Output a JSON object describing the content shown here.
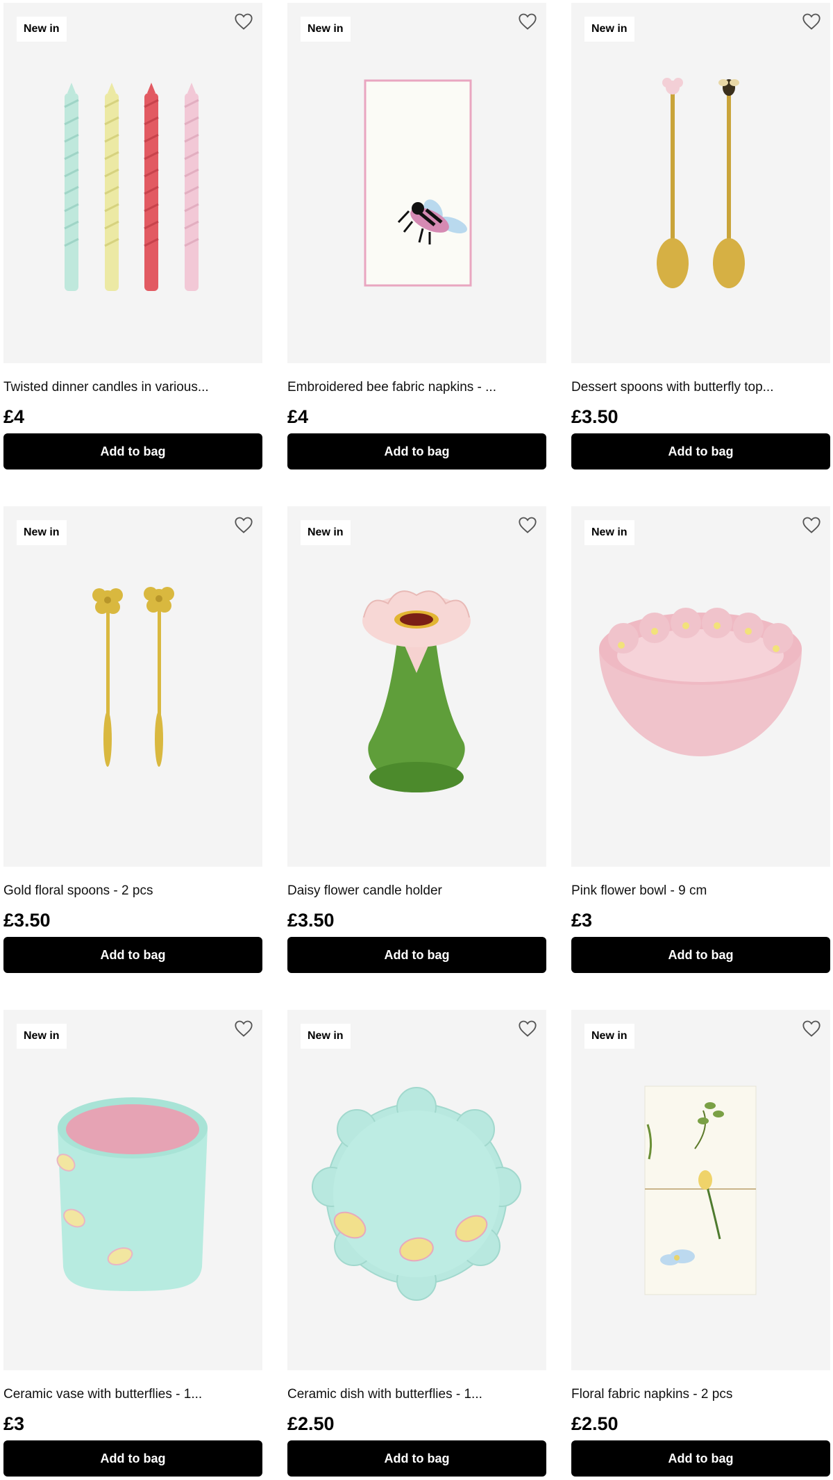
{
  "products": [
    {
      "badge": "New in",
      "title": "Twisted dinner candles in various...",
      "price": "£4",
      "button": "Add to bag",
      "image": "twisted-candles"
    },
    {
      "badge": "New in",
      "title": "Embroidered bee fabric napkins - ...",
      "price": "£4",
      "button": "Add to bag",
      "image": "bee-napkins"
    },
    {
      "badge": "New in",
      "title": "Dessert spoons with butterfly top...",
      "price": "£3.50",
      "button": "Add to bag",
      "image": "dessert-spoons"
    },
    {
      "badge": "New in",
      "title": "Gold floral spoons - 2 pcs",
      "price": "£3.50",
      "button": "Add to bag",
      "image": "gold-floral-spoons"
    },
    {
      "badge": "New in",
      "title": "Daisy flower candle holder",
      "price": "£3.50",
      "button": "Add to bag",
      "image": "daisy-candle-holder"
    },
    {
      "badge": "New in",
      "title": "Pink flower bowl - 9 cm",
      "price": "£3",
      "button": "Add to bag",
      "image": "pink-flower-bowl"
    },
    {
      "badge": "New in",
      "title": "Ceramic vase with butterflies - 1...",
      "price": "£3",
      "button": "Add to bag",
      "image": "butterfly-vase"
    },
    {
      "badge": "New in",
      "title": "Ceramic dish with butterflies - 1...",
      "price": "£2.50",
      "button": "Add to bag",
      "image": "butterfly-dish"
    },
    {
      "badge": "New in",
      "title": "Floral fabric napkins - 2 pcs",
      "price": "£2.50",
      "button": "Add to bag",
      "image": "floral-napkins"
    }
  ],
  "colors": {
    "button_bg": "#000000",
    "button_text": "#ffffff",
    "card_bg": "#f4f4f4"
  }
}
